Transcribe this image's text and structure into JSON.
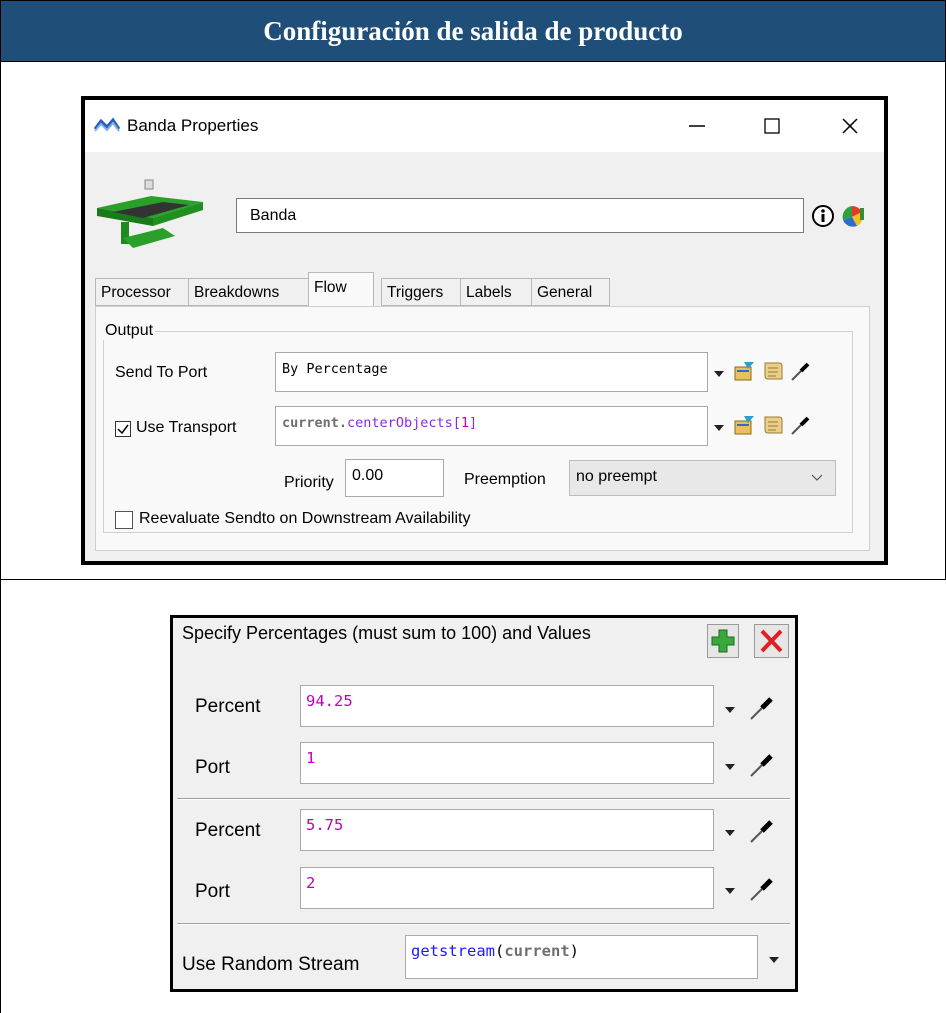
{
  "header": {
    "title": "Configuración de salida de producto"
  },
  "window": {
    "title": "Banda  Properties",
    "object_name": "Banda",
    "tabs": [
      "Processor",
      "Breakdowns",
      "Flow",
      "Triggers",
      "Labels",
      "General"
    ],
    "active_tab": "Flow",
    "output_group": "Output",
    "send_to_port_label": "Send To Port",
    "send_to_port_value": "By Percentage",
    "use_transport_label": "Use Transport",
    "use_transport_checked": true,
    "transport_parts": {
      "keyword": "current",
      "dot": ".",
      "func": "centerObjects",
      "open": "[",
      "index": "1",
      "close": "]"
    },
    "priority_label": "Priority",
    "priority_value": "0.00",
    "preemption_label": "Preemption",
    "preemption_value": "no preempt",
    "reevaluate_label": "Reevaluate Sendto on Downstream Availability",
    "reevaluate_checked": false
  },
  "percentages": {
    "title": "Specify Percentages (must sum to 100) and Values",
    "rows": [
      {
        "percent_label": "Percent",
        "percent": "94.25",
        "port_label": "Port",
        "port": "1"
      },
      {
        "percent_label": "Percent",
        "percent": "5.75",
        "port_label": "Port",
        "port": "2"
      }
    ],
    "random_stream_label": "Use Random Stream",
    "random_stream_func": "getstream",
    "random_stream_open": "(",
    "random_stream_arg": "current",
    "random_stream_close": ")"
  },
  "colors": {
    "header_bg": "#1f4e79",
    "number": "#c000c0",
    "keyword": "#6f6f6f",
    "function": "#8a2be2"
  }
}
